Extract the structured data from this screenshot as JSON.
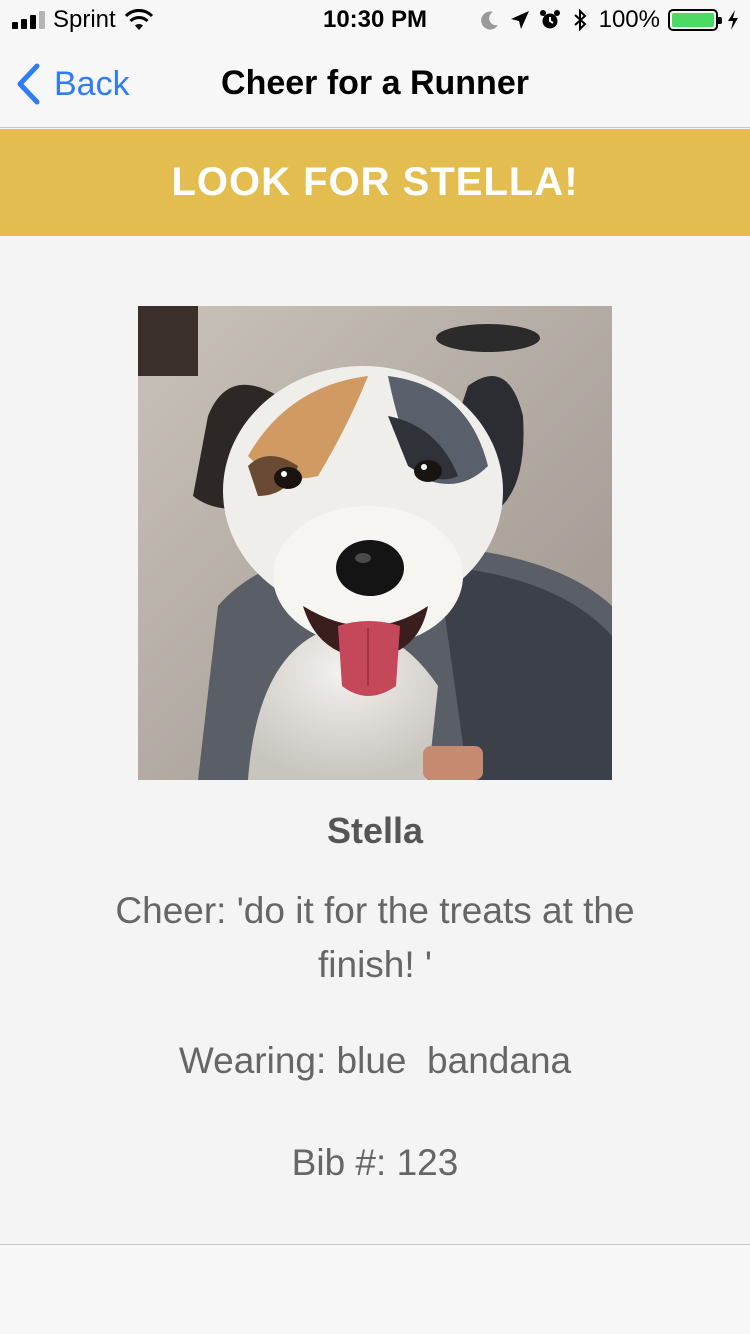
{
  "status_bar": {
    "carrier": "Sprint",
    "time": "10:30 PM",
    "battery_percent": "100%",
    "battery_level": 1.0,
    "icons": [
      "signal-icon",
      "wifi-icon",
      "moon-icon",
      "location-arrow-icon",
      "alarm-icon",
      "bluetooth-icon",
      "battery-icon",
      "charging-bolt-icon"
    ]
  },
  "nav": {
    "back_label": "Back",
    "title": "Cheer for a Runner"
  },
  "banner": {
    "text": "LOOK FOR STELLA!",
    "color": "#e3bd4f"
  },
  "runner": {
    "name": "Stella",
    "cheer": "Cheer: 'do it for the treats at the finish! '",
    "wearing": "Wearing: blue  bandana",
    "bib": "Bib #: 123"
  },
  "colors": {
    "accent": "#2f7cf6",
    "battery_fill": "#4cd964",
    "text_secondary": "#666666"
  }
}
